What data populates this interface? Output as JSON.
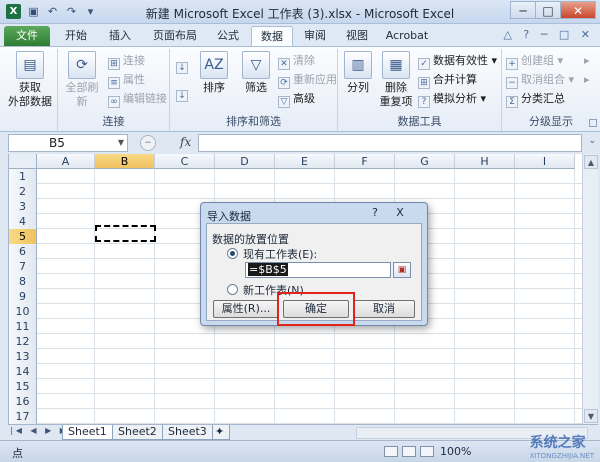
{
  "window": {
    "title": "新建 Microsoft Excel 工作表 (3).xlsx - Microsoft Excel",
    "app_icon": "X",
    "qat": [
      "save-icon",
      "undo-icon",
      "redo-icon",
      "customize-icon"
    ]
  },
  "tabs": [
    "文件",
    "开始",
    "插入",
    "页面布局",
    "公式",
    "数据",
    "审阅",
    "视图",
    "Acrobat"
  ],
  "active_tab": "数据",
  "ribbon": {
    "get_external": {
      "line1": "获取",
      "line2": "外部数据"
    },
    "connections": {
      "refresh_all": "全部刷新",
      "items": [
        "连接",
        "属性",
        "编辑链接"
      ],
      "label": "连接"
    },
    "sort_filter": {
      "sort": "排序",
      "filter": "筛选",
      "items": [
        "清除",
        "重新应用",
        "高级"
      ],
      "label": "排序和筛选"
    },
    "data_tools": {
      "split": "分列",
      "remove_dup": {
        "line1": "删除",
        "line2": "重复项"
      },
      "items": [
        "数据有效性",
        "合并计算",
        "模拟分析"
      ],
      "label": "数据工具"
    },
    "outline": {
      "items": [
        "创建组",
        "取消组合",
        "分类汇总"
      ],
      "label": "分级显示"
    }
  },
  "formula_bar": {
    "name_box": "B5",
    "fx": "fx",
    "value": ""
  },
  "grid": {
    "columns": [
      "A",
      "B",
      "C",
      "D",
      "E",
      "F",
      "G",
      "H",
      "I"
    ],
    "rows": [
      "1",
      "2",
      "3",
      "4",
      "5",
      "6",
      "7",
      "8",
      "9",
      "10",
      "11",
      "12",
      "13",
      "14",
      "15",
      "16",
      "17"
    ],
    "selected_column": "B",
    "selected_row": "5"
  },
  "sheets": [
    "Sheet1",
    "Sheet2",
    "Sheet3"
  ],
  "active_sheet": "Sheet1",
  "status": {
    "mode": "点",
    "zoom": "100%"
  },
  "dialog": {
    "title": "导入数据",
    "help": "?",
    "close": "X",
    "section": "数据的放置位置",
    "option_existing": "现有工作表(E):",
    "ref_value": "=$B$5",
    "option_new": "新工作表(N)",
    "btn_properties": "属性(R)...",
    "btn_ok": "确定",
    "btn_cancel": "取消"
  },
  "watermark": {
    "main": "系统之家",
    "sub": "XITONGZHIJIA.NET"
  },
  "colors": {
    "file_tab": "#2e7d32",
    "highlight": "#e0241c",
    "selection": "#f1c15f"
  }
}
